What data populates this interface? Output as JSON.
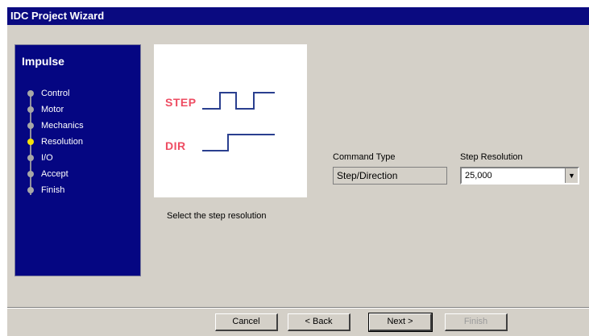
{
  "window": {
    "title": "IDC Project Wizard"
  },
  "sidebar": {
    "title": "Impulse",
    "steps": [
      {
        "label": "Control",
        "active": false
      },
      {
        "label": "Motor",
        "active": false
      },
      {
        "label": "Mechanics",
        "active": false
      },
      {
        "label": "Resolution",
        "active": true
      },
      {
        "label": "I/O",
        "active": false
      },
      {
        "label": "Accept",
        "active": false
      },
      {
        "label": "Finish",
        "active": false
      }
    ]
  },
  "illustration": {
    "step_label": "STEP",
    "dir_label": "DIR"
  },
  "main": {
    "hint": "Select the step resolution",
    "command_type": {
      "label": "Command Type",
      "value": "Step/Direction"
    },
    "step_resolution": {
      "label": "Step Resolution",
      "value": "25,000"
    }
  },
  "buttons": {
    "cancel": "Cancel",
    "back": "< Back",
    "next": "Next >",
    "finish": "Finish"
  },
  "colors": {
    "title_bar": "#0a0a80",
    "sidebar_bg": "#050682",
    "active_dot": "#f5e10a",
    "signal_label": "#ee4c62",
    "signal_line": "#2a3f8f"
  }
}
